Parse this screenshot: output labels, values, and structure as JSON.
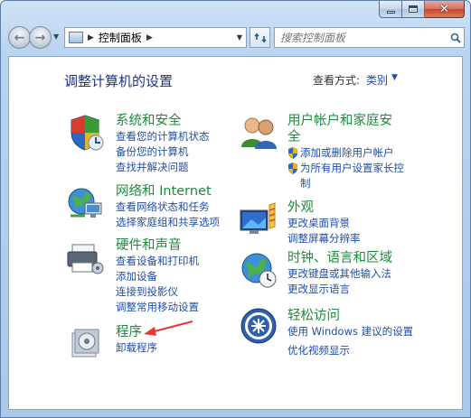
{
  "address": {
    "crumb": "控制面板"
  },
  "search": {
    "placeholder": "搜索控制面板"
  },
  "heading": "调整计算机的设置",
  "view_by": {
    "label": "查看方式:",
    "value": "类别"
  },
  "categories": [
    {
      "title": "系统和安全",
      "links": [
        "查看您的计算机状态",
        "备份您的计算机",
        "查找并解决问题"
      ]
    },
    {
      "title": "网络和 Internet",
      "links": [
        "查看网络状态和任务",
        "选择家庭组和共享选项"
      ]
    },
    {
      "title": "硬件和声音",
      "links": [
        "查看设备和打印机",
        "添加设备",
        "连接到投影仪",
        "调整常用移动设置"
      ]
    },
    {
      "title": "程序",
      "links": [
        "卸载程序"
      ]
    },
    {
      "title": "用户帐户和家庭安全",
      "title_line2": "全",
      "title_line1": "用户帐户和家庭安",
      "links": [
        "添加或删除用户帐户",
        "为所有用户设置家长控",
        "制"
      ]
    },
    {
      "title": "外观",
      "links": [
        "更改桌面背景",
        "调整屏幕分辨率"
      ]
    },
    {
      "title": "时钟、语言和区域",
      "links": [
        "更改键盘或其他输入法",
        "更改显示语言"
      ]
    },
    {
      "title": "轻松访问",
      "links": [
        "使用 Windows 建议的设置",
        "优化视频显示"
      ]
    }
  ],
  "colors": {
    "link": "#1f4ea8",
    "category_title": "#1e8a3d",
    "heading": "#1e3287",
    "annotation_arrow": "#e03a3a"
  }
}
